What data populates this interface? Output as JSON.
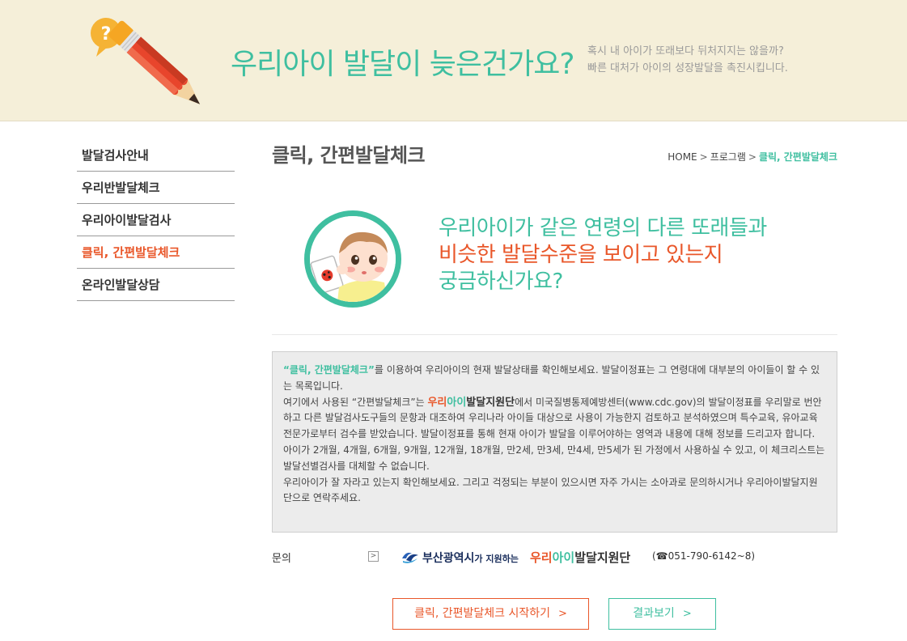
{
  "banner": {
    "title": "우리아이 발달이 늦은건가요?",
    "subtitle_line1": "혹시 내 아이가 또래보다 뒤처지지는 않을까?",
    "subtitle_line2": "빠른 대처가 아이의 성장발달을 촉진시킵니다.",
    "bubble_mark": "?"
  },
  "sidebar": {
    "items": [
      {
        "label": "발달검사안내",
        "active": false
      },
      {
        "label": "우리반발달체크",
        "active": false
      },
      {
        "label": "우리아이발달검사",
        "active": false
      },
      {
        "label": "클릭, 간편발달체크",
        "active": true
      },
      {
        "label": "온라인발달상담",
        "active": false
      }
    ]
  },
  "page": {
    "title": "클릭, 간편발달체크",
    "breadcrumb": {
      "home": "HOME",
      "sep": ">",
      "level1": "프로그램",
      "current": "클릭, 간편발달체크"
    }
  },
  "headline": {
    "line1": "우리아이가 같은 연령의 다른 또래들과",
    "line2": "비슷한 발달수준을 보이고 있는지",
    "line3": "궁금하신가요?"
  },
  "info": {
    "p1_quote": "“클릭, 간편발달체크”",
    "p1_rest": "를 이용하여 우리아이의 현재 발달상태를 확인해보세요. 발달이정표는 그 연령대에 대부분의 아이들이 할 수 있는 목록입니다.",
    "p2_pre": "여기에서 사용된 “간편발달체크”는 ",
    "p2_org_1": "우리",
    "p2_org_2": "아이",
    "p2_org_3": "발달지원단",
    "p2_rest": "에서 미국질병통제예방센터(www.cdc.gov)의 발달이정표를 우리말로 번안하고 다른 발달검사도구들의 문항과 대조하여 우리나라 아이들 대상으로 사용이 가능한지 검토하고 분석하였으며 특수교육, 유아교육 전문가로부터 검수를 받았습니다. 발달이정표를 통해 현재 아이가 발달을 이루어야하는 영역과 내용에 대해 정보를 드리고자 합니다.",
    "p3": "아이가 2개월, 4개월, 6개월, 9개월, 12개월, 18개월, 만2세, 만3세, 만4세, 만5세가 된 가정에서 사용하실 수 있고, 이 체크리스트는 발달선별검사를 대체할 수 없습니다.",
    "p4": "우리아이가 잘 자라고 있는지 확인해보세요. 그리고 걱정되는 부분이 있으시면 자주 가시는 소아과로 문의하시거나 우리아이발달지원단으로 연락주세요."
  },
  "contact": {
    "label": "문의",
    "arrow": ">",
    "sponsor": "부산광역시",
    "sponsor_suffix": "가 지원하는",
    "org_1": "우리",
    "org_2": "아이",
    "org_3": "발달지원단",
    "phone": "(☎051-790-6142~8)"
  },
  "buttons": {
    "start": "클릭, 간편발달체크 시작하기",
    "result": "결과보기",
    "chevron": ">"
  },
  "colors": {
    "accent_green": "#3fbfa0",
    "accent_orange": "#e9572a",
    "banner_bg": "#f5efd9",
    "infobox_bg": "#ececec"
  }
}
